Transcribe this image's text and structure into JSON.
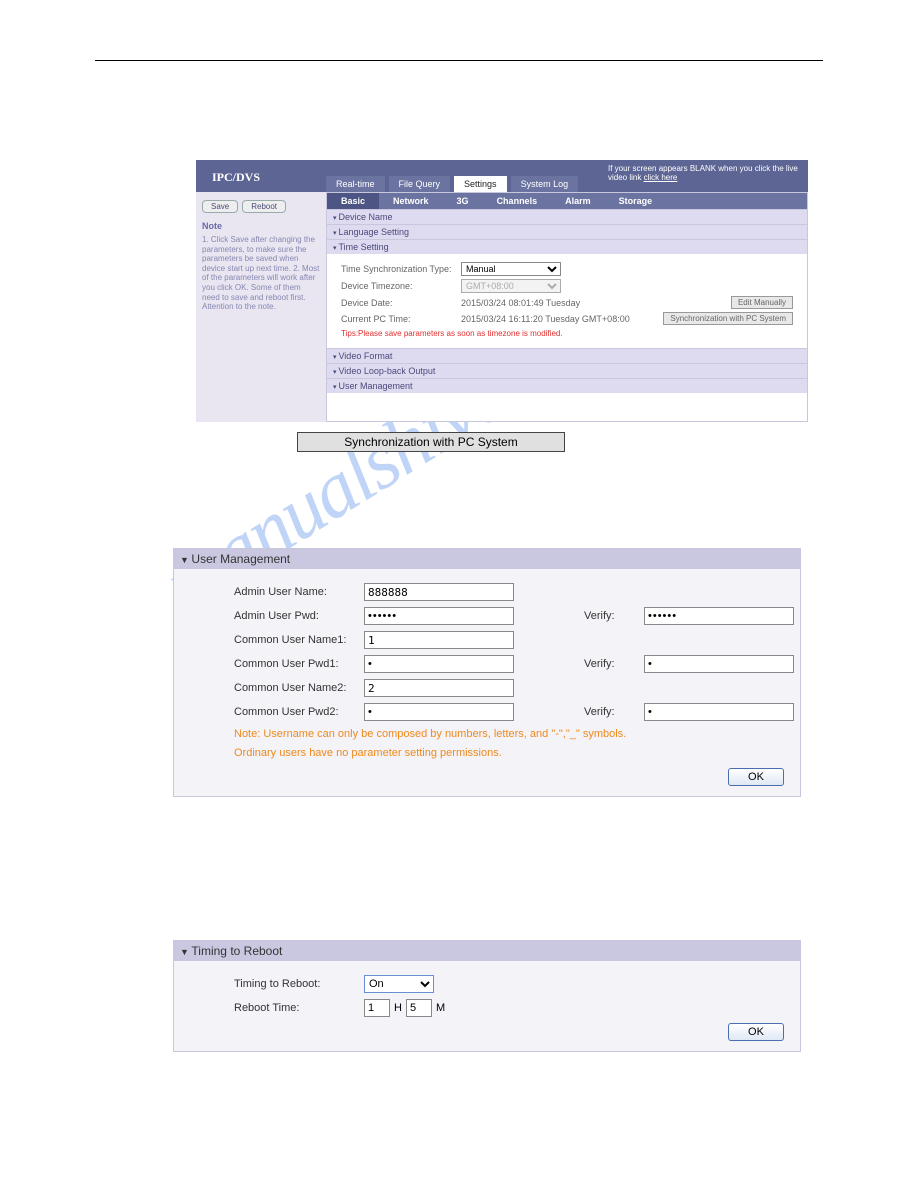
{
  "watermark": "manualshive.com",
  "shot": {
    "logo": "IPC/DVS",
    "blank_msg_a": "If your screen appears BLANK when you click the live video link ",
    "blank_link": "click here",
    "top_tabs": [
      "Real-time",
      "File Query",
      "Settings",
      "System Log"
    ],
    "top_active": 2,
    "side_buttons": [
      "Save",
      "Reboot"
    ],
    "note_h": "Note",
    "note_t": "1. Click Save after changing the parameters, to make sure the parameters be saved when device start up next time. 2. Most of the parameters will work after you click OK. Some of them need to save and reboot first. Attention to the note.",
    "sub_tabs": [
      "Basic",
      "Network",
      "3G",
      "Channels",
      "Alarm",
      "Storage"
    ],
    "sub_active": 0,
    "acc_before": [
      "Device Name",
      "Language Setting",
      "Time Setting"
    ],
    "time": {
      "sync_type_lbl": "Time Synchronization Type:",
      "sync_type_val": "Manual",
      "tz_lbl": "Device Timezone:",
      "tz_val": "GMT+08:00",
      "dev_date_lbl": "Device Date:",
      "dev_date_val": "2015/03/24 08:01:49 Tuesday",
      "pc_time_lbl": "Current PC Time:",
      "pc_time_val": "2015/03/24 16:11:20 Tuesday GMT+08:00",
      "edit_btn": "Edit Manually",
      "sync_btn": "Synchronization with PC System",
      "tips": "Tips:Please save parameters as soon as timezone is modified."
    },
    "acc_after": [
      "Video Format",
      "Video Loop-back Output",
      "User Management"
    ]
  },
  "sync_button": "Synchronization with PC System",
  "um": {
    "header": "User Management",
    "labels": {
      "admin_name": "Admin User Name:",
      "admin_pwd": "Admin User Pwd:",
      "cu_name1": "Common User Name1:",
      "cu_pwd1": "Common User Pwd1:",
      "cu_name2": "Common User Name2:",
      "cu_pwd2": "Common User Pwd2:",
      "verify": "Verify:"
    },
    "vals": {
      "admin_name": "888888",
      "admin_pwd": "••••••",
      "admin_pwd_v": "••••••",
      "cu_name1": "1",
      "cu_pwd1": "•",
      "cu_pwd1_v": "•",
      "cu_name2": "2",
      "cu_pwd2": "•",
      "cu_pwd2_v": "•"
    },
    "note1": "Note: Username can only be composed by numbers, letters, and \"-\",\"_\" symbols.",
    "note2": "Ordinary users have no parameter setting permissions.",
    "ok": "OK"
  },
  "tr": {
    "header": "Timing to Reboot",
    "lbl_mode": "Timing to Reboot:",
    "mode_val": "On",
    "lbl_time": "Reboot Time:",
    "h_val": "1",
    "m_val": "5",
    "h_unit": "H",
    "m_unit": "M",
    "ok": "OK"
  }
}
